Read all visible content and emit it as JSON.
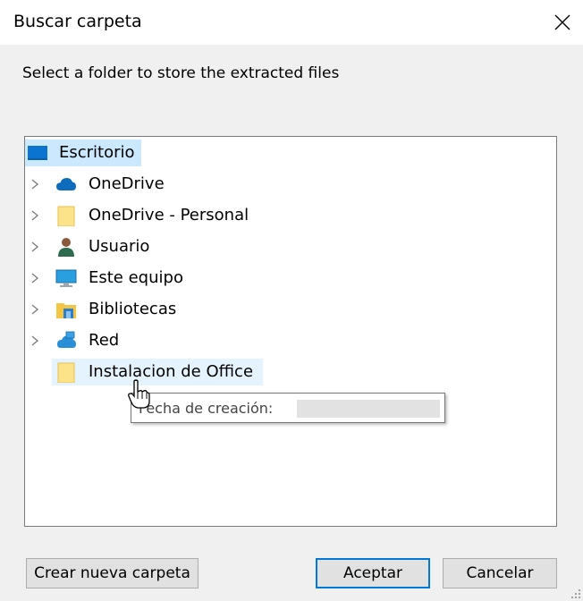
{
  "window": {
    "title": "Buscar carpeta"
  },
  "prompt": "Select a folder to store the extracted files",
  "tree": {
    "items": [
      {
        "label": "Escritorio",
        "icon": "desktop-icon",
        "expandable": false,
        "selected": true
      },
      {
        "label": "OneDrive",
        "icon": "cloud-icon",
        "expandable": true
      },
      {
        "label": "OneDrive - Personal",
        "icon": "folder-icon",
        "expandable": true
      },
      {
        "label": "Usuario",
        "icon": "user-icon",
        "expandable": true
      },
      {
        "label": "Este equipo",
        "icon": "computer-icon",
        "expandable": true
      },
      {
        "label": "Bibliotecas",
        "icon": "library-icon",
        "expandable": true
      },
      {
        "label": "Red",
        "icon": "network-icon",
        "expandable": true
      },
      {
        "label": "Instalacion de Office",
        "icon": "folder-icon",
        "expandable": false,
        "hovered": true
      }
    ]
  },
  "tooltip": {
    "label": "Fecha de creación:"
  },
  "buttons": {
    "new_folder": "Crear nueva carpeta",
    "ok": "Aceptar",
    "cancel": "Cancelar"
  },
  "colors": {
    "selection": "#cce8ff",
    "hover": "#e5f3ff",
    "accent": "#0078d7"
  }
}
